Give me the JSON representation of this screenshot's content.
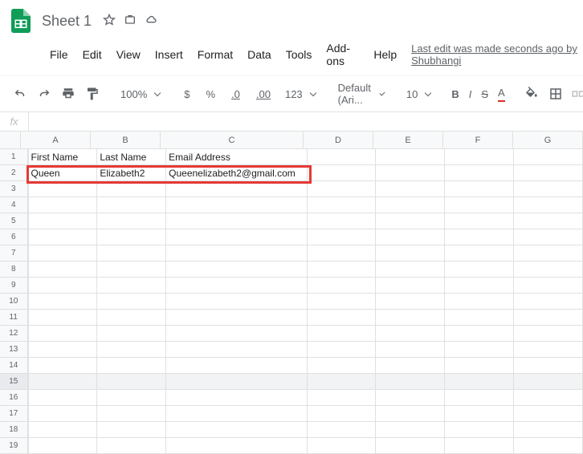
{
  "doc": {
    "title": "Sheet 1"
  },
  "menu": {
    "file": "File",
    "edit": "Edit",
    "view": "View",
    "insert": "Insert",
    "format": "Format",
    "data": "Data",
    "tools": "Tools",
    "addons": "Add-ons",
    "help": "Help"
  },
  "last_edit": "Last edit was made seconds ago by Shubhangi",
  "toolbar": {
    "zoom": "100%",
    "currency": "$",
    "percent": "%",
    "dec_dec": ".0",
    "dec_inc": ".00",
    "num_fmt": "123",
    "font": "Default (Ari...",
    "font_size": "10"
  },
  "fx": {
    "label": "fx",
    "value": ""
  },
  "cols": [
    "A",
    "B",
    "C",
    "D",
    "E",
    "F",
    "G"
  ],
  "data_rows": [
    {
      "n": "1",
      "cells": [
        "First Name",
        "Last Name",
        "Email Address",
        "",
        "",
        "",
        ""
      ]
    },
    {
      "n": "2",
      "cells": [
        "Queen",
        "Elizabeth2",
        "Queenelizabeth2@gmail.com",
        "",
        "",
        "",
        ""
      ]
    }
  ],
  "empty_rows": [
    "3",
    "4",
    "5",
    "6",
    "7",
    "8",
    "9",
    "10",
    "11",
    "12",
    "13",
    "14",
    "15",
    "16",
    "17",
    "18",
    "19"
  ],
  "selected_row": "15"
}
